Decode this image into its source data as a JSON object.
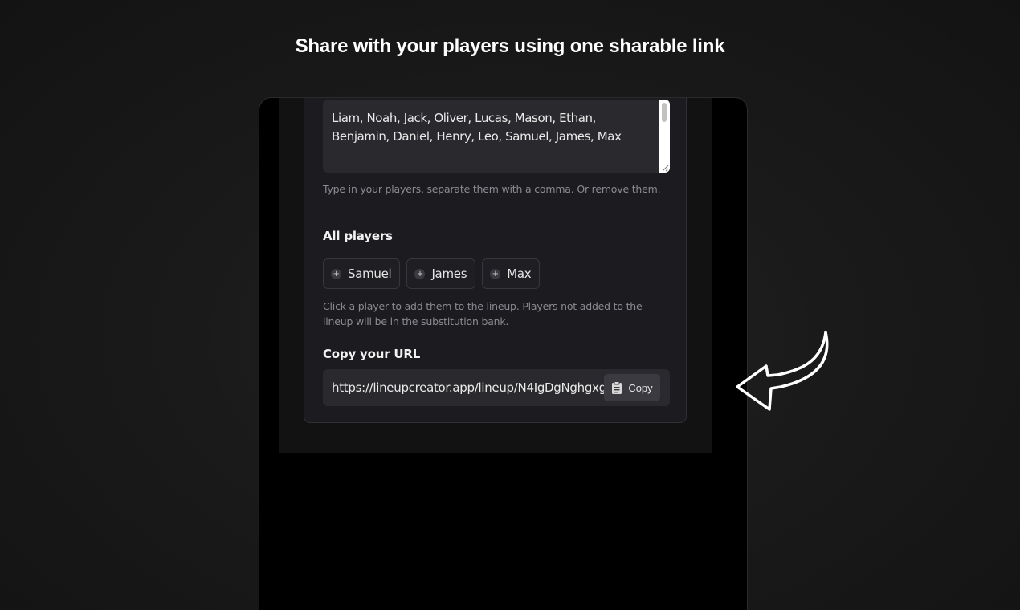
{
  "headline": "Share with your players using one sharable link",
  "players_input": {
    "value": "Liam, Noah, Jack, Oliver, Lucas, Mason, Ethan, Benjamin, Daniel, Henry, Leo, Samuel, James, Max",
    "helper": "Type in your players, separate them with a comma. Or remove them."
  },
  "all_players": {
    "title": "All players",
    "chips": [
      "Samuel",
      "James",
      "Max"
    ],
    "helper": "Click a player to add them to the lineup. Players not added to the lineup will be in the substitution bank."
  },
  "copy_url": {
    "title": "Copy your URL",
    "url": "https://lineupcreator.app/lineup/N4IgDgNghgxg",
    "button_label": "Copy"
  },
  "icons": {
    "chip_icon": "plus-icon",
    "copy_icon": "clipboard-icon",
    "pointer": "curved-arrow-icon"
  },
  "colors": {
    "background": "#1a1a1a",
    "card": "#1c1c20",
    "input": "#2a2a2e",
    "copy_button": "#3a3a40"
  }
}
